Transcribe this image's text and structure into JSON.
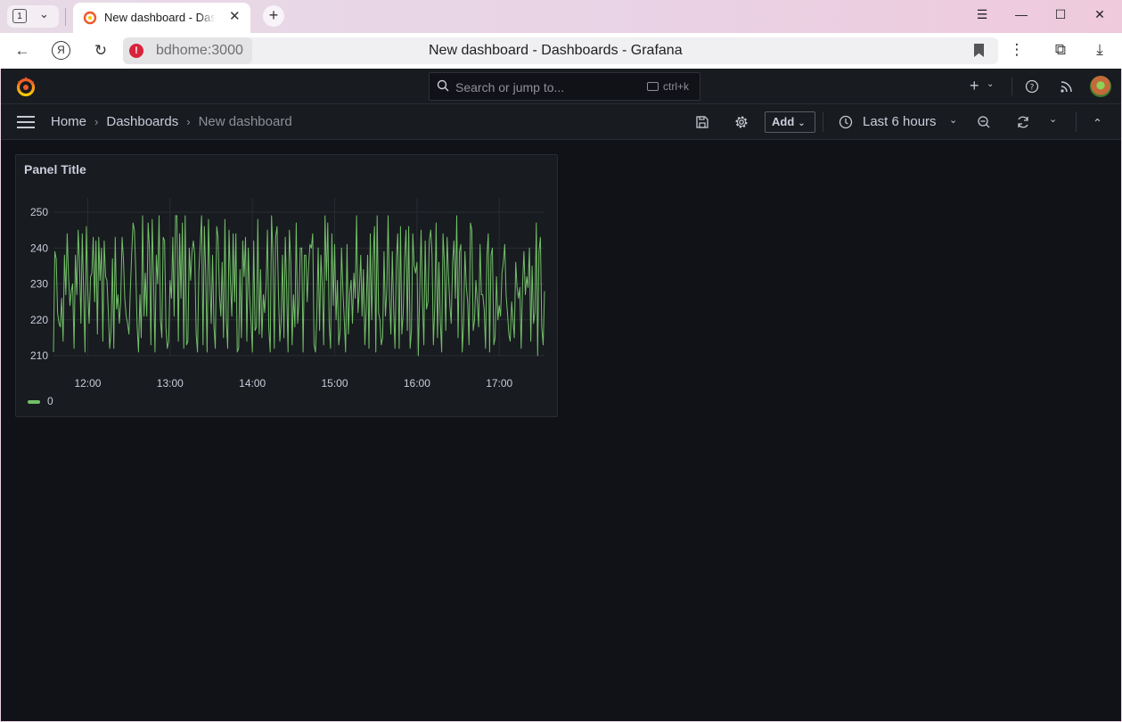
{
  "browser": {
    "tab_count": "1",
    "active_tab_title": "New dashboard - Dashboards - Grafana",
    "address_host": "bdhome:3000",
    "page_title": "New dashboard - Dashboards - Grafana"
  },
  "grafana": {
    "search_placeholder": "Search or jump to...",
    "search_shortcut": "ctrl+k",
    "breadcrumbs": [
      "Home",
      "Dashboards",
      "New dashboard"
    ],
    "add_label": "Add",
    "time_range": "Last 6 hours",
    "accent": "#73bf69"
  },
  "panel": {
    "title": "Panel Title",
    "legend": [
      "0"
    ]
  },
  "chart_data": {
    "type": "line",
    "title": "Panel Title",
    "xlabel": "",
    "ylabel": "",
    "x_ticks": [
      "12:00",
      "13:00",
      "14:00",
      "15:00",
      "16:00",
      "17:00"
    ],
    "y_ticks": [
      210,
      220,
      230,
      240,
      250
    ],
    "ylim": [
      210,
      250
    ],
    "xlim": [
      "11:35",
      "17:35"
    ],
    "grid": true,
    "legend_position": "bottom-left",
    "series": [
      {
        "name": "0",
        "color": "#73bf69",
        "x_minutes_from_start": [
          0,
          1,
          2,
          3,
          4,
          5,
          6,
          7,
          8,
          9,
          10,
          11,
          12,
          13,
          14,
          15,
          16,
          17,
          18,
          19,
          20,
          21,
          22,
          23,
          24,
          25,
          26,
          27,
          28,
          29,
          30,
          31,
          32,
          33,
          34,
          35,
          36,
          37,
          38,
          39,
          40,
          41,
          42,
          43,
          44,
          45,
          46,
          47,
          48,
          49,
          50,
          51,
          52,
          53,
          54,
          55,
          56,
          57,
          58,
          59,
          60,
          61,
          62,
          63,
          64,
          65,
          66,
          67,
          68,
          69,
          70,
          71,
          72,
          73,
          74,
          75,
          76,
          77,
          78,
          79,
          80,
          81,
          82,
          83,
          84,
          85,
          86,
          87,
          88,
          89,
          90,
          91,
          92,
          93,
          94,
          95,
          96,
          97,
          98,
          99,
          100,
          101,
          102,
          103,
          104,
          105,
          106,
          107,
          108,
          109,
          110,
          111,
          112,
          113,
          114,
          115,
          116,
          117,
          118,
          119,
          120,
          121,
          122,
          123,
          124,
          125,
          126,
          127,
          128,
          129,
          130,
          131,
          132,
          133,
          134,
          135,
          136,
          137,
          138,
          139,
          140,
          141,
          142,
          143,
          144,
          145,
          146,
          147,
          148,
          149,
          150,
          151,
          152,
          153,
          154,
          155,
          156,
          157,
          158,
          159,
          160,
          161,
          162,
          163,
          164,
          165,
          166,
          167,
          168,
          169,
          170,
          171,
          172,
          173,
          174,
          175,
          176,
          177,
          178,
          179,
          180,
          181,
          182,
          183,
          184,
          185,
          186,
          187,
          188,
          189,
          190,
          191,
          192,
          193,
          194,
          195,
          196,
          197,
          198,
          199,
          200,
          201,
          202,
          203,
          204,
          205,
          206,
          207,
          208,
          209,
          210,
          211,
          212,
          213,
          214,
          215,
          216,
          217,
          218,
          219,
          220,
          221,
          222,
          223,
          224,
          225,
          226,
          227,
          228,
          229,
          230,
          231,
          232,
          233,
          234,
          235,
          236,
          237,
          238,
          239,
          240,
          241,
          242,
          243,
          244,
          245,
          246,
          247,
          248,
          249,
          250,
          251,
          252,
          253,
          254,
          255,
          256,
          257,
          258,
          259,
          260,
          261,
          262,
          263,
          264,
          265,
          266,
          267,
          268,
          269,
          270,
          271,
          272,
          273,
          274,
          275,
          276,
          277,
          278,
          279,
          280,
          281,
          282,
          283,
          284,
          285,
          286,
          287,
          288,
          289,
          290,
          291,
          292,
          293,
          294,
          295,
          296,
          297,
          298,
          299,
          300,
          301,
          302,
          303,
          304,
          305,
          306,
          307,
          308,
          309,
          310,
          311,
          312,
          313,
          314,
          315,
          316,
          317,
          318,
          319,
          320,
          321,
          322,
          323,
          324,
          325,
          326,
          327,
          328,
          329,
          330,
          331,
          332,
          333,
          334,
          335,
          336,
          337,
          338,
          339,
          340,
          341,
          342,
          343,
          344,
          345,
          346,
          347,
          348,
          349,
          350,
          351,
          352,
          353,
          354,
          355,
          356,
          357,
          358
        ],
        "values": [
          211,
          239,
          237,
          222,
          219,
          218,
          226,
          214,
          238,
          227,
          244,
          232,
          224,
          228,
          230,
          212,
          238,
          227,
          245,
          236,
          219,
          244,
          227,
          211,
          246,
          228,
          219,
          232,
          233,
          243,
          225,
          242,
          216,
          243,
          231,
          240,
          214,
          242,
          232,
          231,
          222,
          212,
          217,
          237,
          212,
          243,
          223,
          227,
          219,
          225,
          243,
          237,
          226,
          221,
          219,
          216,
          228,
          238,
          247,
          245,
          234,
          218,
          211,
          227,
          215,
          249,
          221,
          233,
          221,
          247,
          240,
          213,
          248,
          230,
          211,
          238,
          230,
          249,
          220,
          215,
          243,
          242,
          218,
          212,
          214,
          231,
          226,
          243,
          221,
          249,
          249,
          214,
          244,
          226,
          247,
          212,
          249,
          213,
          214,
          240,
          231,
          239,
          242,
          238,
          216,
          211,
          233,
          241,
          249,
          213,
          246,
          233,
          211,
          248,
          231,
          219,
          238,
          218,
          212,
          246,
          243,
          227,
          221,
          236,
          215,
          248,
          220,
          212,
          245,
          231,
          221,
          244,
          225,
          244,
          211,
          212,
          234,
          215,
          242,
          232,
          243,
          214,
          240,
          227,
          220,
          211,
          242,
          217,
          218,
          248,
          216,
          234,
          215,
          227,
          222,
          230,
          245,
          218,
          211,
          249,
          238,
          212,
          243,
          246,
          228,
          214,
          220,
          238,
          215,
          243,
          229,
          211,
          245,
          236,
          213,
          227,
          218,
          247,
          219,
          225,
          240,
          240,
          211,
          238,
          238,
          225,
          235,
          241,
          240,
          244,
          213,
          211,
          221,
          240,
          217,
          238,
          229,
          213,
          249,
          231,
          247,
          219,
          212,
          244,
          224,
          241,
          220,
          231,
          213,
          217,
          240,
          228,
          220,
          211,
          241,
          216,
          227,
          231,
          219,
          233,
          226,
          249,
          222,
          228,
          238,
          221,
          234,
          213,
          223,
          238,
          212,
          244,
          220,
          236,
          246,
          211,
          249,
          222,
          220,
          213,
          215,
          239,
          221,
          228,
          249,
          226,
          216,
          239,
          223,
          212,
          237,
          244,
          212,
          246,
          216,
          222,
          237,
          245,
          217,
          246,
          212,
          217,
          244,
          235,
          233,
          236,
          210,
          227,
          245,
          226,
          213,
          242,
          223,
          225,
          242,
          245,
          238,
          213,
          224,
          247,
          215,
          236,
          220,
          211,
          244,
          236,
          217,
          243,
          232,
          224,
          219,
          236,
          242,
          226,
          249,
          215,
          239,
          241,
          211,
          219,
          239,
          229,
          225,
          213,
          247,
          245,
          217,
          220,
          231,
          225,
          218,
          241,
          227,
          227,
          223,
          212,
          238,
          244,
          211,
          238,
          240,
          213,
          215,
          232,
          220,
          224,
          221,
          233,
          236,
          241,
          227,
          222,
          216,
          214,
          225,
          220,
          215,
          236,
          229,
          226,
          229,
          212,
          230,
          239,
          227,
          232,
          229,
          240,
          214,
          235,
          219,
          222,
          247,
          210,
          239,
          243,
          218,
          213,
          228,
          232,
          218,
          214,
          231,
          236,
          211,
          212,
          249,
          247,
          223,
          213,
          222,
          236,
          212,
          211,
          221,
          249,
          238,
          243
        ]
      }
    ]
  }
}
